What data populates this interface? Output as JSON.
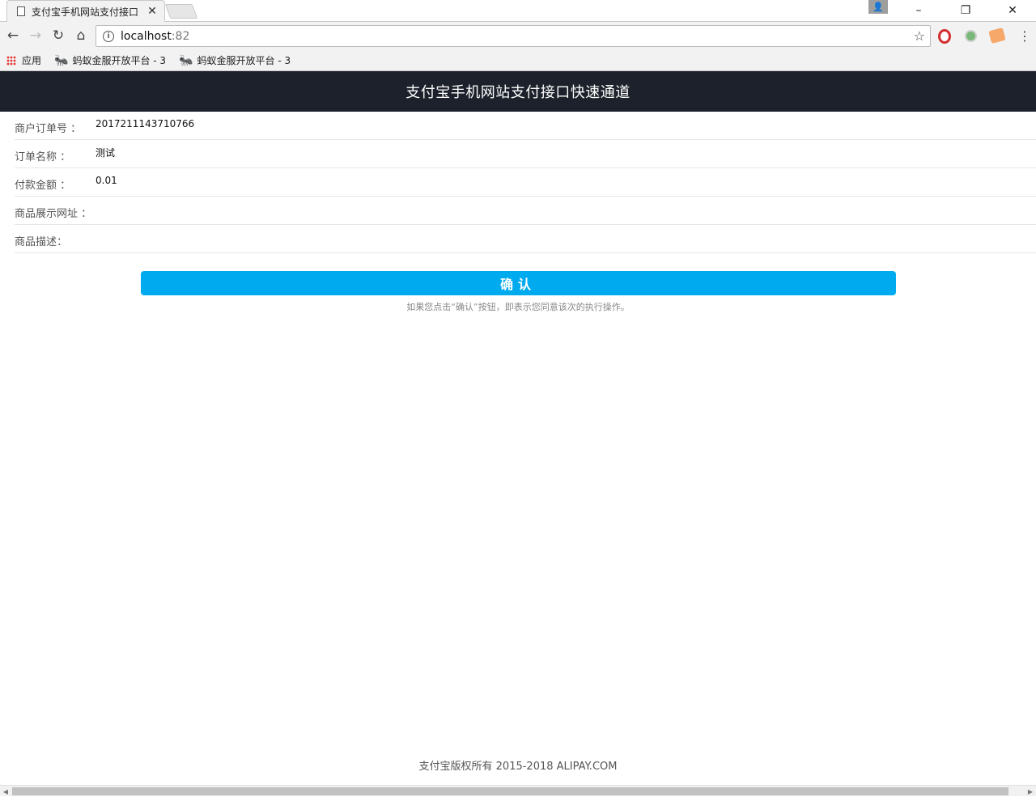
{
  "browser": {
    "tab_title": "支付宝手机网站支付接口",
    "url_host": "localhost",
    "url_port": ":82",
    "bookmarks": [
      {
        "label": "应用"
      },
      {
        "label": "蚂蚁金服开放平台 - 3"
      },
      {
        "label": "蚂蚁金服开放平台 - 3"
      }
    ]
  },
  "page": {
    "header_title": "支付宝手机网站支付接口快速通道",
    "fields": [
      {
        "label": "商户订单号 ：",
        "value": "2017211143710766"
      },
      {
        "label": "订单名称 ：",
        "value": "测试"
      },
      {
        "label": "付款金额 ：",
        "value": "0.01"
      },
      {
        "label": "商品展示网址 ：",
        "value": ""
      },
      {
        "label": "商品描述：",
        "value": ""
      }
    ],
    "confirm_label": "确认",
    "confirm_note": "如果您点击“确认”按钮，即表示您同意该次的执行操作。",
    "footer": "支付宝版权所有 2015-2018 ALIPAY.COM"
  },
  "colors": {
    "header_bg": "#1c212b",
    "accent": "#00aaee"
  }
}
